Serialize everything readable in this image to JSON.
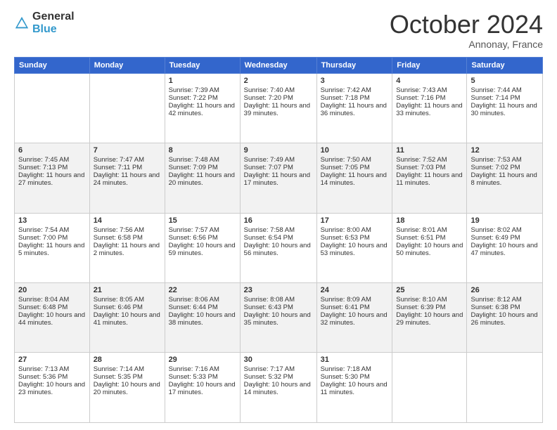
{
  "header": {
    "logo_general": "General",
    "logo_blue": "Blue",
    "month": "October 2024",
    "location": "Annonay, France"
  },
  "weekdays": [
    "Sunday",
    "Monday",
    "Tuesday",
    "Wednesday",
    "Thursday",
    "Friday",
    "Saturday"
  ],
  "weeks": [
    [
      {
        "day": "",
        "sunrise": "",
        "sunset": "",
        "daylight": "",
        "empty": true
      },
      {
        "day": "",
        "sunrise": "",
        "sunset": "",
        "daylight": "",
        "empty": true
      },
      {
        "day": "1",
        "sunrise": "Sunrise: 7:39 AM",
        "sunset": "Sunset: 7:22 PM",
        "daylight": "Daylight: 11 hours and 42 minutes."
      },
      {
        "day": "2",
        "sunrise": "Sunrise: 7:40 AM",
        "sunset": "Sunset: 7:20 PM",
        "daylight": "Daylight: 11 hours and 39 minutes."
      },
      {
        "day": "3",
        "sunrise": "Sunrise: 7:42 AM",
        "sunset": "Sunset: 7:18 PM",
        "daylight": "Daylight: 11 hours and 36 minutes."
      },
      {
        "day": "4",
        "sunrise": "Sunrise: 7:43 AM",
        "sunset": "Sunset: 7:16 PM",
        "daylight": "Daylight: 11 hours and 33 minutes."
      },
      {
        "day": "5",
        "sunrise": "Sunrise: 7:44 AM",
        "sunset": "Sunset: 7:14 PM",
        "daylight": "Daylight: 11 hours and 30 minutes."
      }
    ],
    [
      {
        "day": "6",
        "sunrise": "Sunrise: 7:45 AM",
        "sunset": "Sunset: 7:13 PM",
        "daylight": "Daylight: 11 hours and 27 minutes."
      },
      {
        "day": "7",
        "sunrise": "Sunrise: 7:47 AM",
        "sunset": "Sunset: 7:11 PM",
        "daylight": "Daylight: 11 hours and 24 minutes."
      },
      {
        "day": "8",
        "sunrise": "Sunrise: 7:48 AM",
        "sunset": "Sunset: 7:09 PM",
        "daylight": "Daylight: 11 hours and 20 minutes."
      },
      {
        "day": "9",
        "sunrise": "Sunrise: 7:49 AM",
        "sunset": "Sunset: 7:07 PM",
        "daylight": "Daylight: 11 hours and 17 minutes."
      },
      {
        "day": "10",
        "sunrise": "Sunrise: 7:50 AM",
        "sunset": "Sunset: 7:05 PM",
        "daylight": "Daylight: 11 hours and 14 minutes."
      },
      {
        "day": "11",
        "sunrise": "Sunrise: 7:52 AM",
        "sunset": "Sunset: 7:03 PM",
        "daylight": "Daylight: 11 hours and 11 minutes."
      },
      {
        "day": "12",
        "sunrise": "Sunrise: 7:53 AM",
        "sunset": "Sunset: 7:02 PM",
        "daylight": "Daylight: 11 hours and 8 minutes."
      }
    ],
    [
      {
        "day": "13",
        "sunrise": "Sunrise: 7:54 AM",
        "sunset": "Sunset: 7:00 PM",
        "daylight": "Daylight: 11 hours and 5 minutes."
      },
      {
        "day": "14",
        "sunrise": "Sunrise: 7:56 AM",
        "sunset": "Sunset: 6:58 PM",
        "daylight": "Daylight: 11 hours and 2 minutes."
      },
      {
        "day": "15",
        "sunrise": "Sunrise: 7:57 AM",
        "sunset": "Sunset: 6:56 PM",
        "daylight": "Daylight: 10 hours and 59 minutes."
      },
      {
        "day": "16",
        "sunrise": "Sunrise: 7:58 AM",
        "sunset": "Sunset: 6:54 PM",
        "daylight": "Daylight: 10 hours and 56 minutes."
      },
      {
        "day": "17",
        "sunrise": "Sunrise: 8:00 AM",
        "sunset": "Sunset: 6:53 PM",
        "daylight": "Daylight: 10 hours and 53 minutes."
      },
      {
        "day": "18",
        "sunrise": "Sunrise: 8:01 AM",
        "sunset": "Sunset: 6:51 PM",
        "daylight": "Daylight: 10 hours and 50 minutes."
      },
      {
        "day": "19",
        "sunrise": "Sunrise: 8:02 AM",
        "sunset": "Sunset: 6:49 PM",
        "daylight": "Daylight: 10 hours and 47 minutes."
      }
    ],
    [
      {
        "day": "20",
        "sunrise": "Sunrise: 8:04 AM",
        "sunset": "Sunset: 6:48 PM",
        "daylight": "Daylight: 10 hours and 44 minutes."
      },
      {
        "day": "21",
        "sunrise": "Sunrise: 8:05 AM",
        "sunset": "Sunset: 6:46 PM",
        "daylight": "Daylight: 10 hours and 41 minutes."
      },
      {
        "day": "22",
        "sunrise": "Sunrise: 8:06 AM",
        "sunset": "Sunset: 6:44 PM",
        "daylight": "Daylight: 10 hours and 38 minutes."
      },
      {
        "day": "23",
        "sunrise": "Sunrise: 8:08 AM",
        "sunset": "Sunset: 6:43 PM",
        "daylight": "Daylight: 10 hours and 35 minutes."
      },
      {
        "day": "24",
        "sunrise": "Sunrise: 8:09 AM",
        "sunset": "Sunset: 6:41 PM",
        "daylight": "Daylight: 10 hours and 32 minutes."
      },
      {
        "day": "25",
        "sunrise": "Sunrise: 8:10 AM",
        "sunset": "Sunset: 6:39 PM",
        "daylight": "Daylight: 10 hours and 29 minutes."
      },
      {
        "day": "26",
        "sunrise": "Sunrise: 8:12 AM",
        "sunset": "Sunset: 6:38 PM",
        "daylight": "Daylight: 10 hours and 26 minutes."
      }
    ],
    [
      {
        "day": "27",
        "sunrise": "Sunrise: 7:13 AM",
        "sunset": "Sunset: 5:36 PM",
        "daylight": "Daylight: 10 hours and 23 minutes."
      },
      {
        "day": "28",
        "sunrise": "Sunrise: 7:14 AM",
        "sunset": "Sunset: 5:35 PM",
        "daylight": "Daylight: 10 hours and 20 minutes."
      },
      {
        "day": "29",
        "sunrise": "Sunrise: 7:16 AM",
        "sunset": "Sunset: 5:33 PM",
        "daylight": "Daylight: 10 hours and 17 minutes."
      },
      {
        "day": "30",
        "sunrise": "Sunrise: 7:17 AM",
        "sunset": "Sunset: 5:32 PM",
        "daylight": "Daylight: 10 hours and 14 minutes."
      },
      {
        "day": "31",
        "sunrise": "Sunrise: 7:18 AM",
        "sunset": "Sunset: 5:30 PM",
        "daylight": "Daylight: 10 hours and 11 minutes."
      },
      {
        "day": "",
        "sunrise": "",
        "sunset": "",
        "daylight": "",
        "empty": true
      },
      {
        "day": "",
        "sunrise": "",
        "sunset": "",
        "daylight": "",
        "empty": true
      }
    ]
  ]
}
